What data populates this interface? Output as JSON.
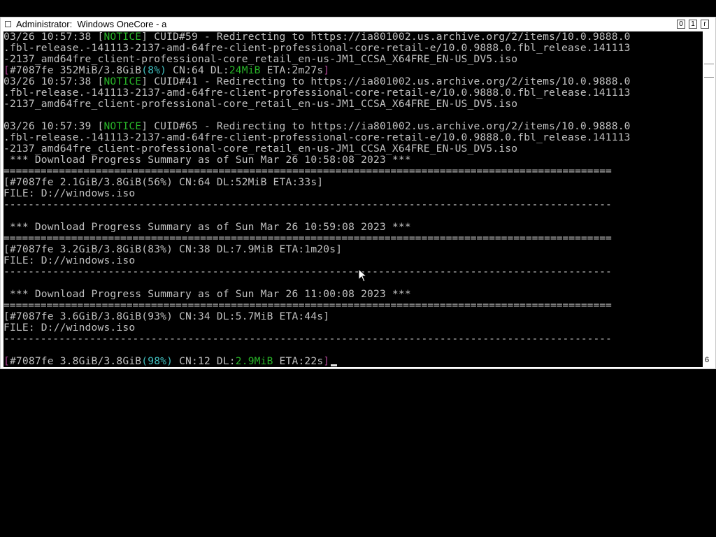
{
  "window": {
    "title": "Administrator:  Windows OneCore - a",
    "controls": {
      "minimize": "0",
      "maximize": "1",
      "close": "r"
    },
    "scroll_label": "6"
  },
  "console": {
    "l1": {
      "ts": "03/26 10:57:38 ",
      "lb": "[",
      "tag": "NOTICE",
      "rb": "]",
      "msg": " CUID#59 - Redirecting to https://ia801002.us.archive.org/2/items/10.0.9888.0"
    },
    "l2": ".fbl-release.-141113-2137-amd-64fre-client-professional-core-retail-e/10.0.9888.0.fbl_release.141113",
    "l3": "-2137_amd64fre_client-professional-core_retail_en-us-JM1_CCSA_X64FRE_EN-US_DV5.iso",
    "l4": {
      "open": "[",
      "head": "#7087fe 352MiB/3.8GiB",
      "pct": "(8%)",
      "mid": " CN:64 DL:",
      "dl": "24MiB",
      "tail": " ETA:2m27s",
      "close": "]"
    },
    "l5": {
      "ts": "03/26 10:57:38 ",
      "lb": "[",
      "tag": "NOTICE",
      "rb": "]",
      "msg": " CUID#41 - Redirecting to https://ia801002.us.archive.org/2/items/10.0.9888.0"
    },
    "l6": ".fbl-release.-141113-2137-amd-64fre-client-professional-core-retail-e/10.0.9888.0.fbl_release.141113",
    "l7": "-2137_amd64fre_client-professional-core_retail_en-us-JM1_CCSA_X64FRE_EN-US_DV5.iso",
    "l9": {
      "ts": "03/26 10:57:39 ",
      "lb": "[",
      "tag": "NOTICE",
      "rb": "]",
      "msg": " CUID#65 - Redirecting to https://ia801002.us.archive.org/2/items/10.0.9888.0"
    },
    "l10": ".fbl-release.-141113-2137-amd-64fre-client-professional-core-retail-e/10.0.9888.0.fbl_release.141113",
    "l11": "-2137_amd64fre_client-professional-core_retail_en-us-JM1_CCSA_X64FRE_EN-US_DV5.iso",
    "l12": " *** Download Progress Summary as of Sun Mar 26 10:58:08 2023 ***",
    "eq": "===================================================================================================",
    "dash": "---------------------------------------------------------------------------------------------------",
    "l14": "[#7087fe 2.1GiB/3.8GiB(56%) CN:64 DL:52MiB ETA:33s]",
    "l15": "FILE: D://windows.iso",
    "l18": " *** Download Progress Summary as of Sun Mar 26 10:59:08 2023 ***",
    "l20": "[#7087fe 3.2GiB/3.8GiB(83%) CN:38 DL:7.9MiB ETA:1m20s]",
    "l21": "FILE: D://windows.iso",
    "l24": " *** Download Progress Summary as of Sun Mar 26 11:00:08 2023 ***",
    "l26": "[#7087fe 3.6GiB/3.8GiB(93%) CN:34 DL:5.7MiB ETA:44s]",
    "l27": "FILE: D://windows.iso",
    "l30": {
      "open": "[",
      "head": "#7087fe 3.8GiB/3.8GiB",
      "pct": "(98%)",
      "mid": " CN:12 DL:",
      "dl": "2.9MiB",
      "tail": " ETA:22s",
      "close": "]"
    }
  }
}
